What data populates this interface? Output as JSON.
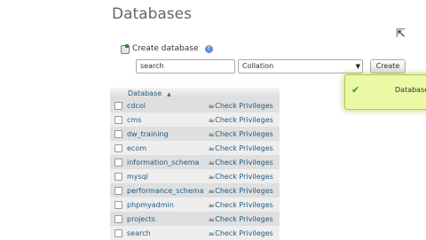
{
  "page": {
    "title": "Databases"
  },
  "create_db": {
    "label": "Create database",
    "help": "?",
    "name_value": "search",
    "collation_value": "Collation",
    "create_label": "Create"
  },
  "notification": {
    "text": "Database"
  },
  "table": {
    "header_name": "Database",
    "sort_glyph": "▲",
    "privilege_icon": "a≡",
    "rows": [
      {
        "name": "cdcol",
        "action": "Check Privileges"
      },
      {
        "name": "cms",
        "action": "Check Privileges"
      },
      {
        "name": "dw_training",
        "action": "Check Privileges"
      },
      {
        "name": "ecom",
        "action": "Check Privileges"
      },
      {
        "name": "information_schema",
        "action": "Check Privileges"
      },
      {
        "name": "mysql",
        "action": "Check Privileges"
      },
      {
        "name": "performance_schema",
        "action": "Check Privileges"
      },
      {
        "name": "phpmyadmin",
        "action": "Check Privileges"
      },
      {
        "name": "projects",
        "action": "Check Privileges"
      },
      {
        "name": "search",
        "action": "Check Privileges"
      }
    ]
  },
  "colors": {
    "link": "#235a81",
    "row_odd": "#dfdfdf",
    "row_even": "#eeeeee",
    "success_bg": "#ebf8a4"
  }
}
